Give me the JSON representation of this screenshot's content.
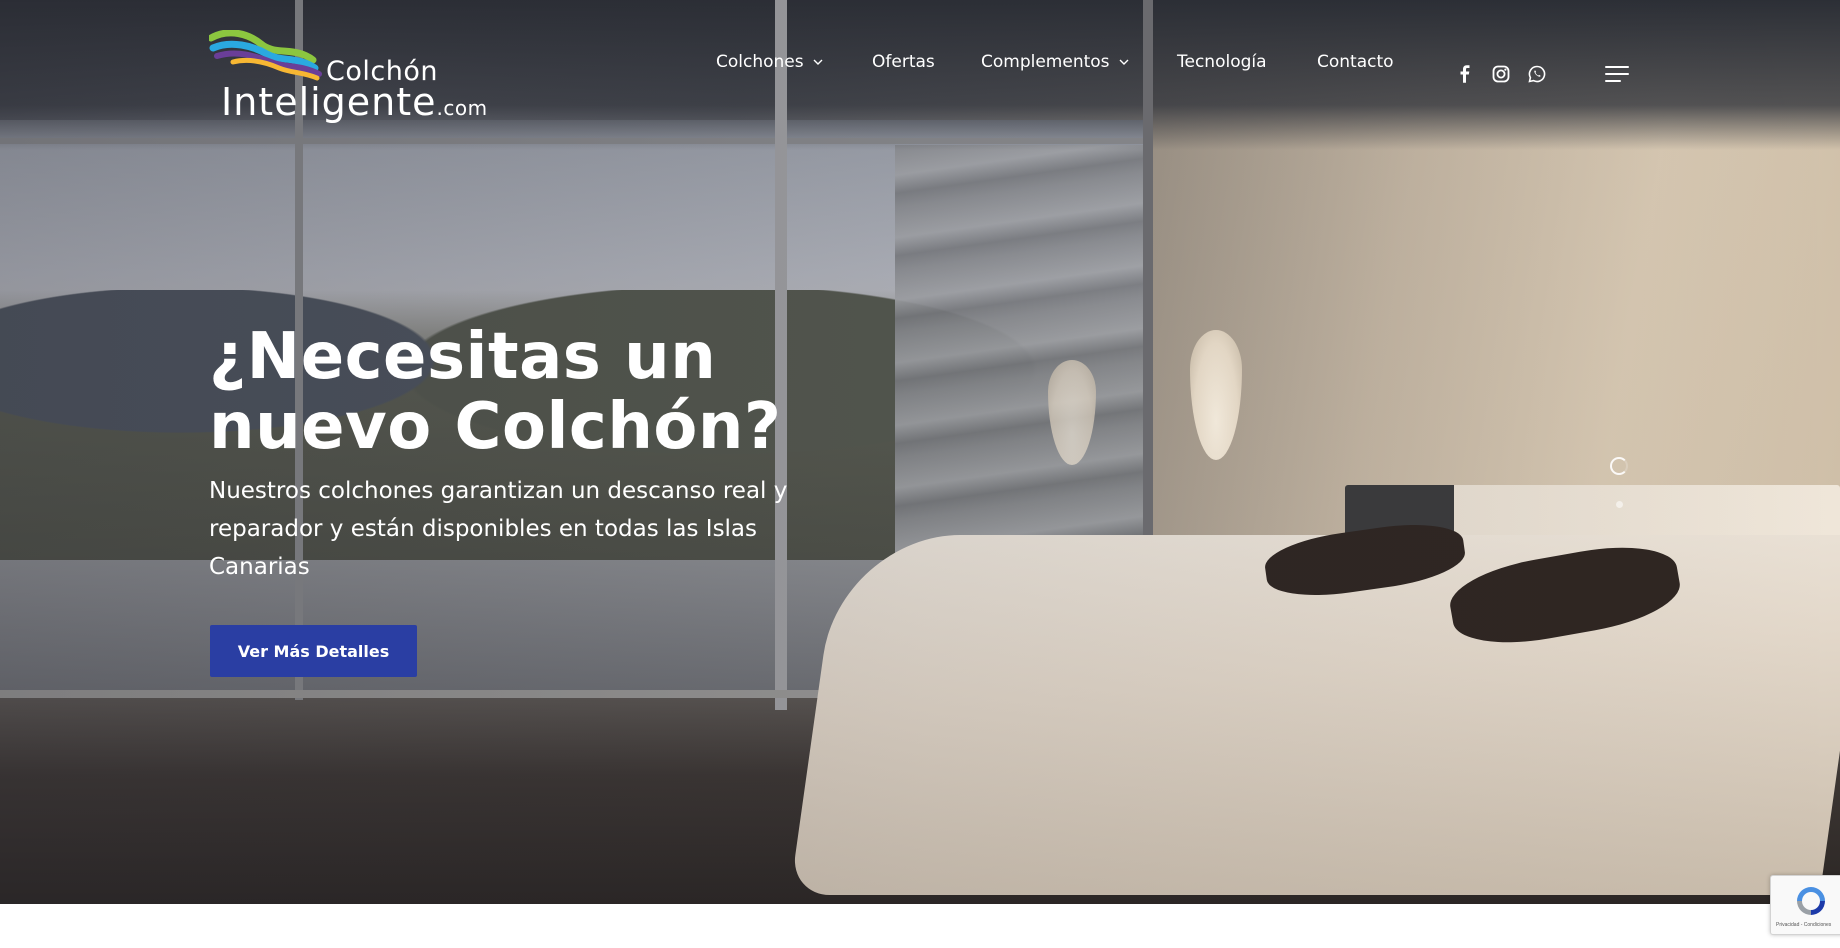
{
  "logo": {
    "line1": "Colchón",
    "line2": "Inteligente",
    "tld": ".com"
  },
  "nav": {
    "items": [
      {
        "label": "Colchones",
        "has_dropdown": true
      },
      {
        "label": "Ofertas",
        "has_dropdown": false
      },
      {
        "label": "Complementos",
        "has_dropdown": true
      },
      {
        "label": "Tecnología",
        "has_dropdown": false
      },
      {
        "label": "Contacto",
        "has_dropdown": false
      }
    ],
    "social_icons": [
      "facebook-icon",
      "instagram-icon",
      "whatsapp-icon"
    ],
    "menu_icon": "hamburger-menu-icon"
  },
  "hero": {
    "title_line1": "¿Necesitas un",
    "title_line2": "nuevo Colchón?",
    "subtitle": "Nuestros colchones garantizan un descanso real y reparador y están disponibles en todas las Islas Canarias",
    "cta_label": "Ver Más Detalles"
  },
  "recaptcha": {
    "text": "Privacidad - Condiciones"
  },
  "colors": {
    "cta_background": "#2a3ea3",
    "text": "#ffffff"
  }
}
